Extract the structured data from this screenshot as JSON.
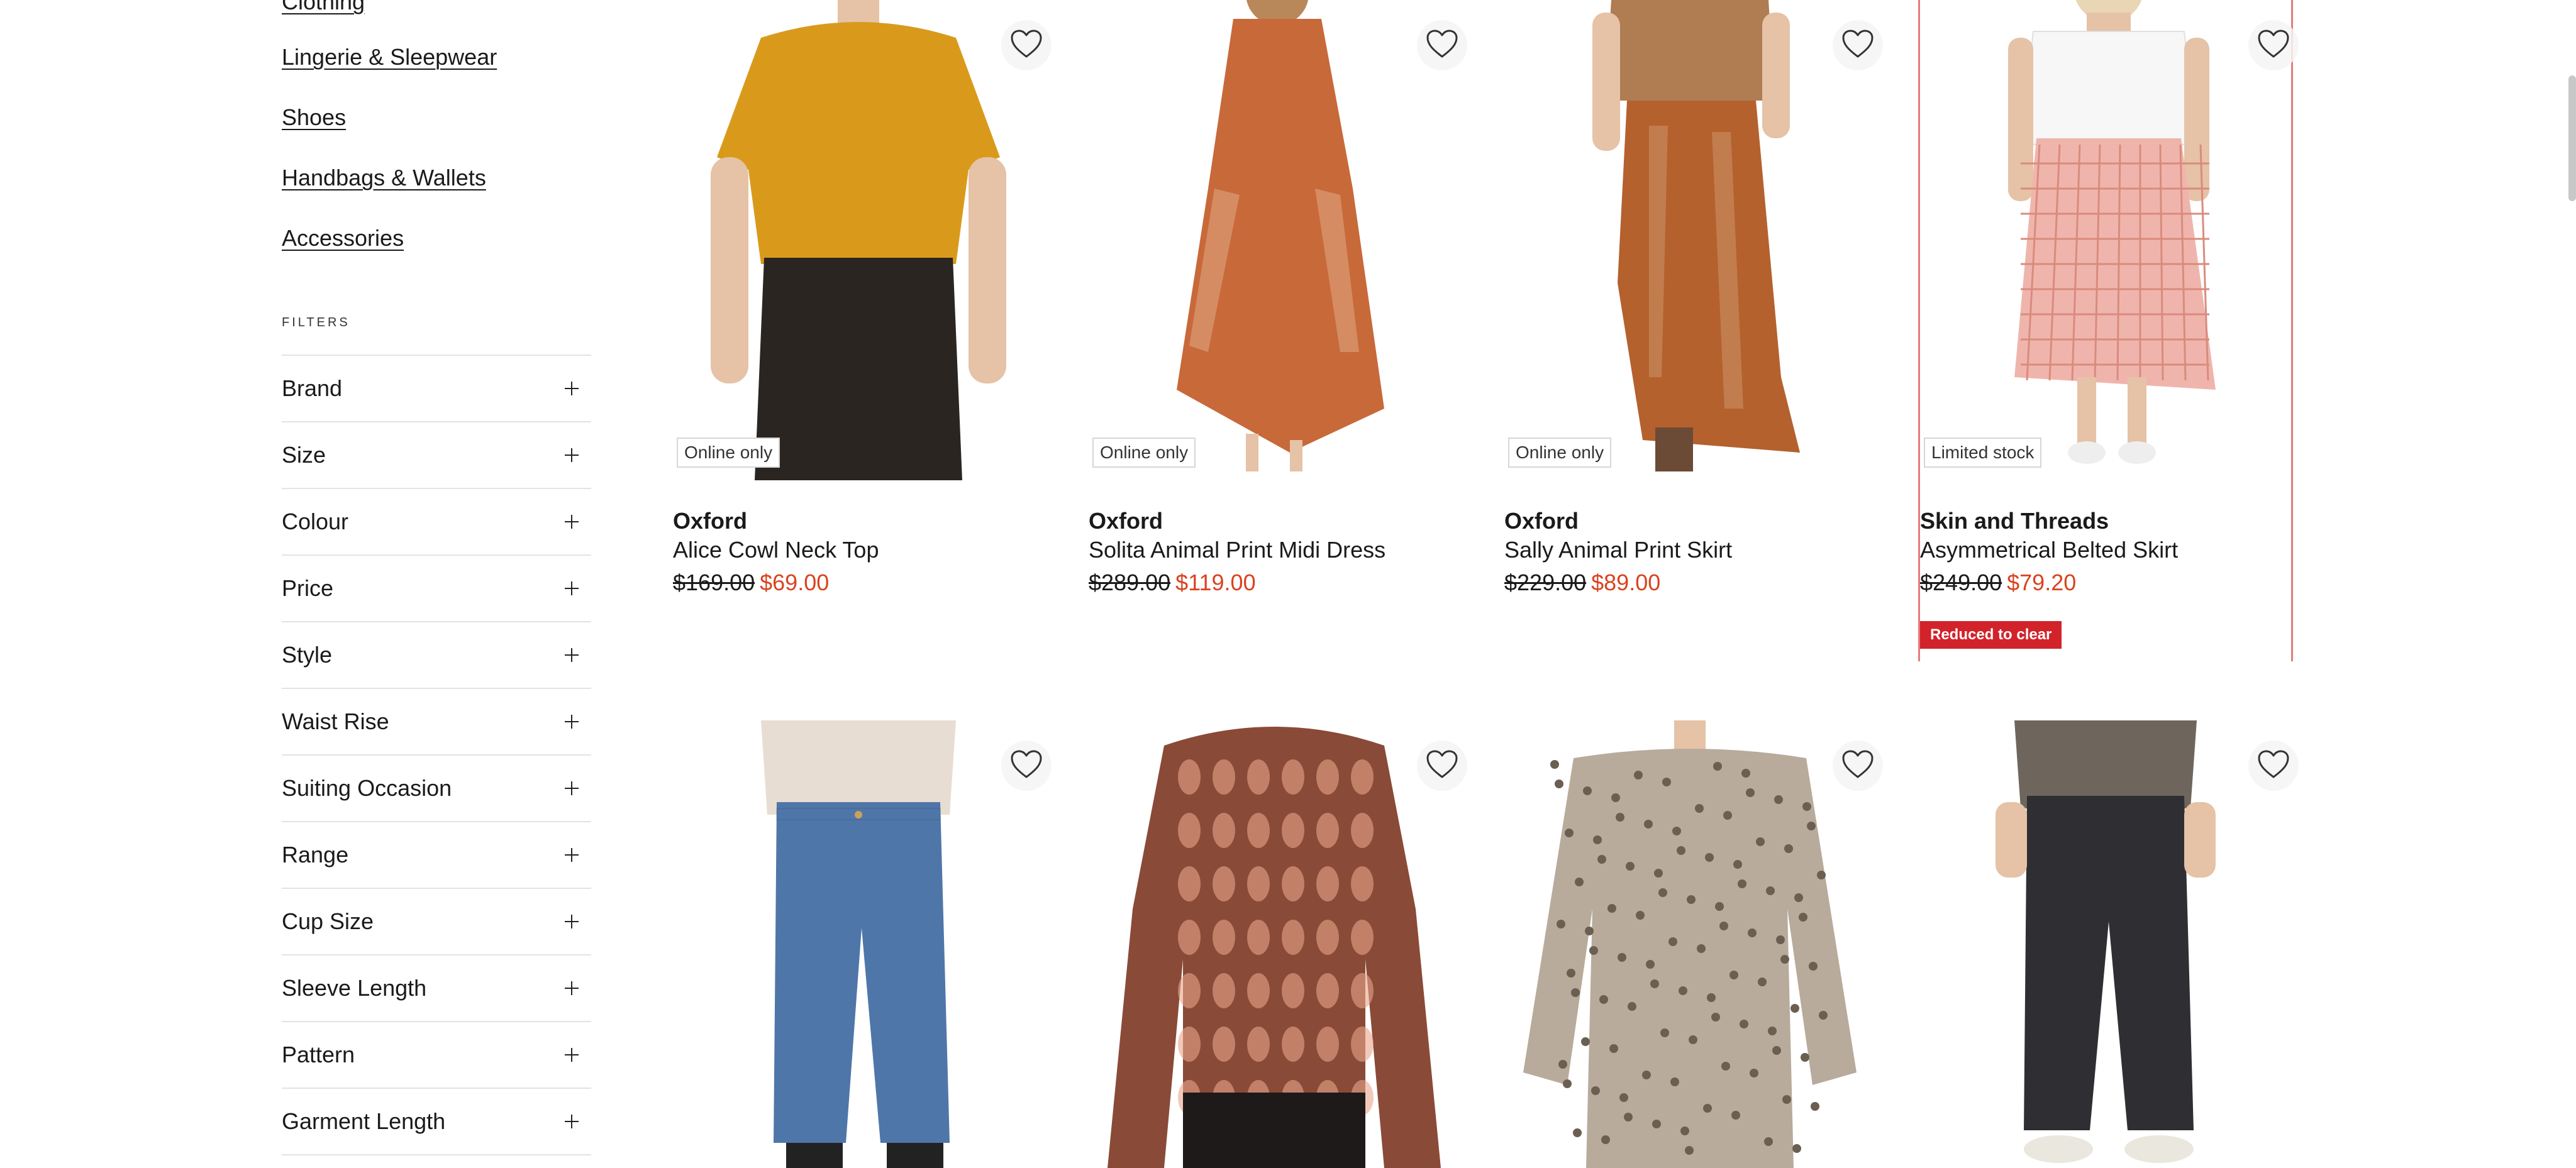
{
  "sidebar": {
    "categories": [
      {
        "label": "Clothing"
      },
      {
        "label": "Lingerie & Sleepwear"
      },
      {
        "label": "Shoes"
      },
      {
        "label": "Handbags & Wallets"
      },
      {
        "label": "Accessories"
      }
    ],
    "filters_heading": "FILTERS",
    "filters": [
      {
        "label": "Brand"
      },
      {
        "label": "Size"
      },
      {
        "label": "Colour"
      },
      {
        "label": "Price"
      },
      {
        "label": "Style"
      },
      {
        "label": "Waist Rise"
      },
      {
        "label": "Suiting Occasion"
      },
      {
        "label": "Range"
      },
      {
        "label": "Cup Size"
      },
      {
        "label": "Sleeve Length"
      },
      {
        "label": "Pattern"
      },
      {
        "label": "Garment Length"
      }
    ]
  },
  "products": [
    {
      "brand": "Oxford",
      "name": "Alice Cowl Neck Top",
      "was_price": "$169.00",
      "now_price": "$69.00",
      "tag": "Online only",
      "badge": "",
      "image": "yellow-cowl-top",
      "colors": {
        "main": "#d99a1c",
        "alt": "#2b2522"
      }
    },
    {
      "brand": "Oxford",
      "name": "Solita Animal Print Midi Dress",
      "was_price": "$289.00",
      "now_price": "$119.00",
      "tag": "Online only",
      "badge": "",
      "image": "orange-print-dress",
      "colors": {
        "main": "#c8693a",
        "alt": "#e3b08a"
      }
    },
    {
      "brand": "Oxford",
      "name": "Sally Animal Print Skirt",
      "was_price": "$229.00",
      "now_price": "$89.00",
      "tag": "Online only",
      "badge": "",
      "image": "animal-print-skirt",
      "colors": {
        "main": "#b4612e",
        "alt": "#d09a6e"
      }
    },
    {
      "brand": "Skin and Threads",
      "name": "Asymmetrical Belted Skirt",
      "was_price": "$249.00",
      "now_price": "$79.20",
      "tag": "Limited stock",
      "badge": "Reduced to clear",
      "image": "pink-check-skirt",
      "colors": {
        "main": "#efb5ad",
        "alt": "#f7f7f7"
      }
    },
    {
      "image": "blue-denim-jeans",
      "colors": {
        "main": "#4f76a8",
        "alt": "#e8ddd2"
      }
    },
    {
      "image": "brown-print-blouse",
      "colors": {
        "main": "#8a4a38",
        "alt": "#1e1a1a"
      }
    },
    {
      "image": "leopard-print-top",
      "colors": {
        "main": "#6b5f52",
        "alt": "#b8ab9c"
      }
    },
    {
      "image": "black-denim-jeans",
      "colors": {
        "main": "#2f2f33",
        "alt": "#6e665d"
      }
    }
  ]
}
